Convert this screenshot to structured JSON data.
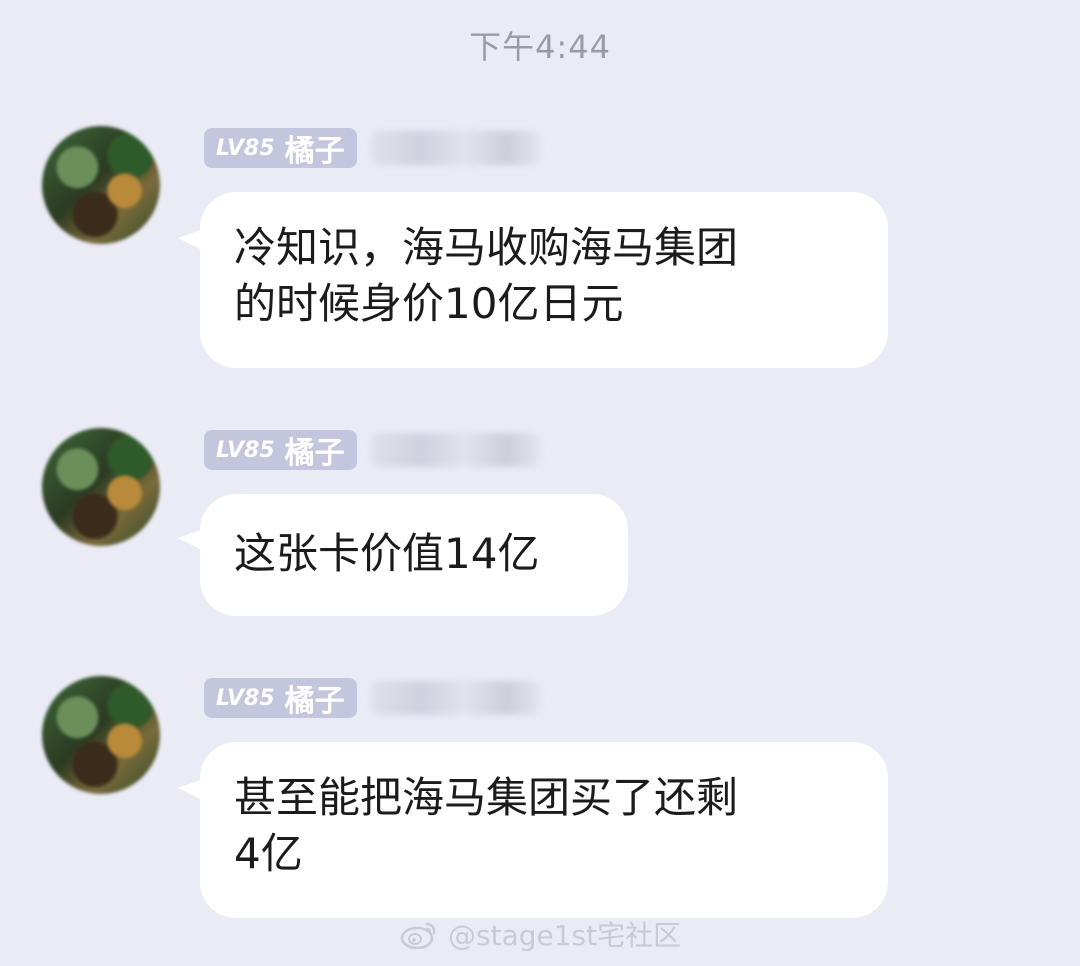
{
  "timestamp": "下午4:44",
  "messages": [
    {
      "sender_level": "LV85",
      "sender_title": "橘子",
      "text": "冷知识，海马收购海马集团\n的时候身价10亿日元"
    },
    {
      "sender_level": "LV85",
      "sender_title": "橘子",
      "text": "这张卡价值14亿"
    },
    {
      "sender_level": "LV85",
      "sender_title": "橘子",
      "text": "甚至能把海马集团买了还剩\n4亿"
    }
  ],
  "watermark": {
    "icon": "weibo-icon",
    "text": "@stage1st宅社区"
  }
}
